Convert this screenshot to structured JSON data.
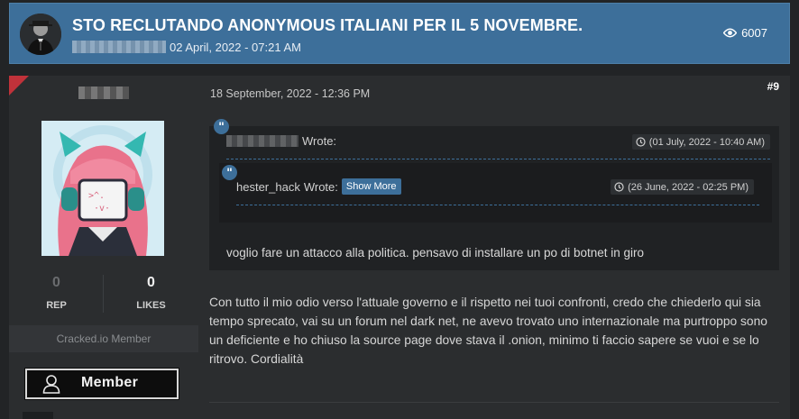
{
  "thread": {
    "title": "STO RECLUTANDO ANONYMOUS ITALIANI PER IL 5 NOVEMBRE.",
    "date": "02 April, 2022 - 07:21 AM",
    "views": "6007"
  },
  "author": {
    "rep_value": "0",
    "rep_label": "REP",
    "likes_value": "0",
    "likes_label": "LIKES",
    "member_title": "Cracked.io Member",
    "rank_badge": "Member"
  },
  "post": {
    "date": "18 September, 2022 - 12:36 PM",
    "number": "#9",
    "outer_quote": {
      "wrote": "Wrote:",
      "time": "(01 July, 2022 - 10:40 AM)",
      "body": "voglio fare un attacco alla politica. pensavo di installare un po di botnet in giro"
    },
    "inner_quote": {
      "author": "hester_hack",
      "wrote": "Wrote:",
      "show_more": "Show More",
      "time": "(26 June, 2022 - 02:25 PM)"
    },
    "body": "Con tutto il mio odio verso l'attuale governo e il rispetto nei tuoi confronti, credo che chiederlo qui sia tempo sprecato, vai su un forum nel dark net, ne avevo trovato uno internazionale ma purtroppo sono un deficiente e ho chiuso la source page dove stava il .onion, minimo ti faccio sapere se vuoi e se lo ritrovo. Cordialità"
  },
  "icons": [
    "eye-icon",
    "clock-icon",
    "quote-icon",
    "user-icon"
  ],
  "colors": {
    "accent": "#3d6f9a",
    "corner": "#c0323a",
    "background": "#222426"
  }
}
